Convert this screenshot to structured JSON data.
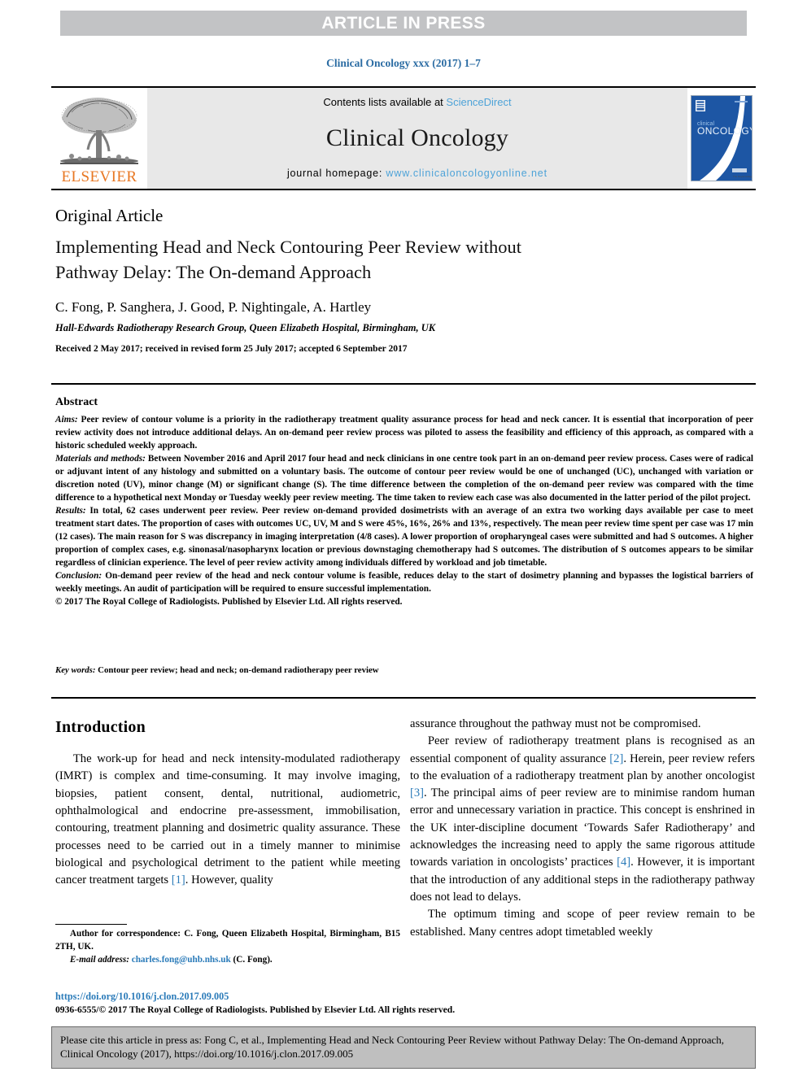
{
  "banner": {
    "text": "ARTICLE IN PRESS"
  },
  "running_head": "Clinical Oncology xxx (2017) 1–7",
  "masthead": {
    "publisher_name": "ELSEVIER",
    "contents_prefix": "Contents lists available at ",
    "contents_link": "ScienceDirect",
    "journal_name": "Clinical Oncology",
    "homepage_prefix": "journal homepage: ",
    "homepage_url": "www.clinicaloncologyonline.net",
    "cover_title_small": "clinical",
    "cover_title_large": "ONCOLOGY"
  },
  "article": {
    "type": "Original Article",
    "title": "Implementing Head and Neck Contouring Peer Review without Pathway Delay: The On-demand Approach",
    "authors": "C. Fong, P. Sanghera, J. Good, P. Nightingale, A. Hartley",
    "affiliation": "Hall-Edwards Radiotherapy Research Group, Queen Elizabeth Hospital, Birmingham, UK",
    "dates": "Received 2 May 2017; received in revised form 25 July 2017; accepted 6 September 2017"
  },
  "abstract": {
    "heading": "Abstract",
    "sections": [
      {
        "label": "Aims:",
        "text": " Peer review of contour volume is a priority in the radiotherapy treatment quality assurance process for head and neck cancer. It is essential that incorporation of peer review activity does not introduce additional delays. An on-demand peer review process was piloted to assess the feasibility and efficiency of this approach, as compared with a historic scheduled weekly approach."
      },
      {
        "label": "Materials and methods:",
        "text": " Between November 2016 and April 2017 four head and neck clinicians in one centre took part in an on-demand peer review process. Cases were of radical or adjuvant intent of any histology and submitted on a voluntary basis. The outcome of contour peer review would be one of unchanged (UC), unchanged with variation or discretion noted (UV), minor change (M) or significant change (S). The time difference between the completion of the on-demand peer review was compared with the time difference to a hypothetical next Monday or Tuesday weekly peer review meeting. The time taken to review each case was also documented in the latter period of the pilot project."
      },
      {
        "label": "Results:",
        "text": " In total, 62 cases underwent peer review. Peer review on-demand provided dosimetrists with an average of an extra two working days available per case to meet treatment start dates. The proportion of cases with outcomes UC, UV, M and S were 45%, 16%, 26% and 13%, respectively. The mean peer review time spent per case was 17 min (12 cases). The main reason for S was discrepancy in imaging interpretation (4/8 cases). A lower proportion of oropharyngeal cases were submitted and had S outcomes. A higher proportion of complex cases, e.g. sinonasal/nasopharynx location or previous downstaging chemotherapy had S outcomes. The distribution of S outcomes appears to be similar regardless of clinician experience. The level of peer review activity among individuals differed by workload and job timetable."
      },
      {
        "label": "Conclusion:",
        "text": " On-demand peer review of the head and neck contour volume is feasible, reduces delay to the start of dosimetry planning and bypasses the logistical barriers of weekly meetings. An audit of participation will be required to ensure successful implementation."
      }
    ],
    "copyright": "© 2017 The Royal College of Radiologists. Published by Elsevier Ltd. All rights reserved."
  },
  "keywords": {
    "label": "Key words:",
    "text": " Contour peer review; head and neck; on-demand radiotherapy peer review"
  },
  "introduction": {
    "heading": "Introduction",
    "left_paragraphs": [
      {
        "pre": "The work-up for head and neck intensity-modulated radiotherapy (IMRT) is complex and time-consuming. It may involve imaging, biopsies, patient consent, dental, nutritional, audiometric, ophthalmological and endocrine pre-assessment, immobilisation, contouring, treatment planning and dosimetric quality assurance. These processes need to be carried out in a timely manner to minimise biological and psychological detriment to the patient while meeting cancer treatment targets ",
        "ref": "[1]",
        "post": ". However, quality"
      }
    ],
    "right_paragraphs": [
      {
        "indent": false,
        "pre": "assurance throughout the pathway must not be compromised.",
        "ref": "",
        "post": ""
      },
      {
        "indent": true,
        "pre": "Peer review of radiotherapy treatment plans is recognised as an essential component of quality assurance ",
        "ref": "[2]",
        "mid": ". Herein, peer review refers to the evaluation of a radiotherapy treatment plan by another oncologist ",
        "ref2": "[3]",
        "post": ". The principal aims of peer review are to minimise random human error and unnecessary variation in practice. This concept is enshrined in the UK inter-discipline document ‘Towards Safer Radiotherapy’ and acknowledges the increasing need to apply the same rigorous attitude towards variation in oncologists’ practices ",
        "ref3": "[4]",
        "tail": ". However, it is important that the introduction of any additional steps in the radiotherapy pathway does not lead to delays."
      },
      {
        "indent": true,
        "pre": "The optimum timing and scope of peer review remain to be established. Many centres adopt timetabled weekly",
        "ref": "",
        "post": ""
      }
    ]
  },
  "footnote": {
    "correspondence": "Author for correspondence: C. Fong, Queen Elizabeth Hospital, Birmingham, B15 2TH, UK.",
    "email_label": "E-mail address:",
    "email": "charles.fong@uhb.nhs.uk",
    "email_suffix": " (C. Fong).",
    "doi": "https://doi.org/10.1016/j.clon.2017.09.005",
    "copyright": "0936-6555/© 2017 The Royal College of Radiologists. Published by Elsevier Ltd. All rights reserved."
  },
  "cite_box": {
    "text": "Please cite this article in press as: Fong C, et al., Implementing Head and Neck Contouring Peer Review without Pathway Delay: The On-demand Approach, Clinical Oncology (2017), https://doi.org/10.1016/j.clon.2017.09.005"
  },
  "colors": {
    "banner_gray": "#c2c3c5",
    "link_blue": "#2b7bb9",
    "elsevier_orange": "#e87722",
    "masthead_gray": "#e8e8e8",
    "cover_blue": "#1a4f9c",
    "cite_box_gray": "#bfbfbf"
  }
}
